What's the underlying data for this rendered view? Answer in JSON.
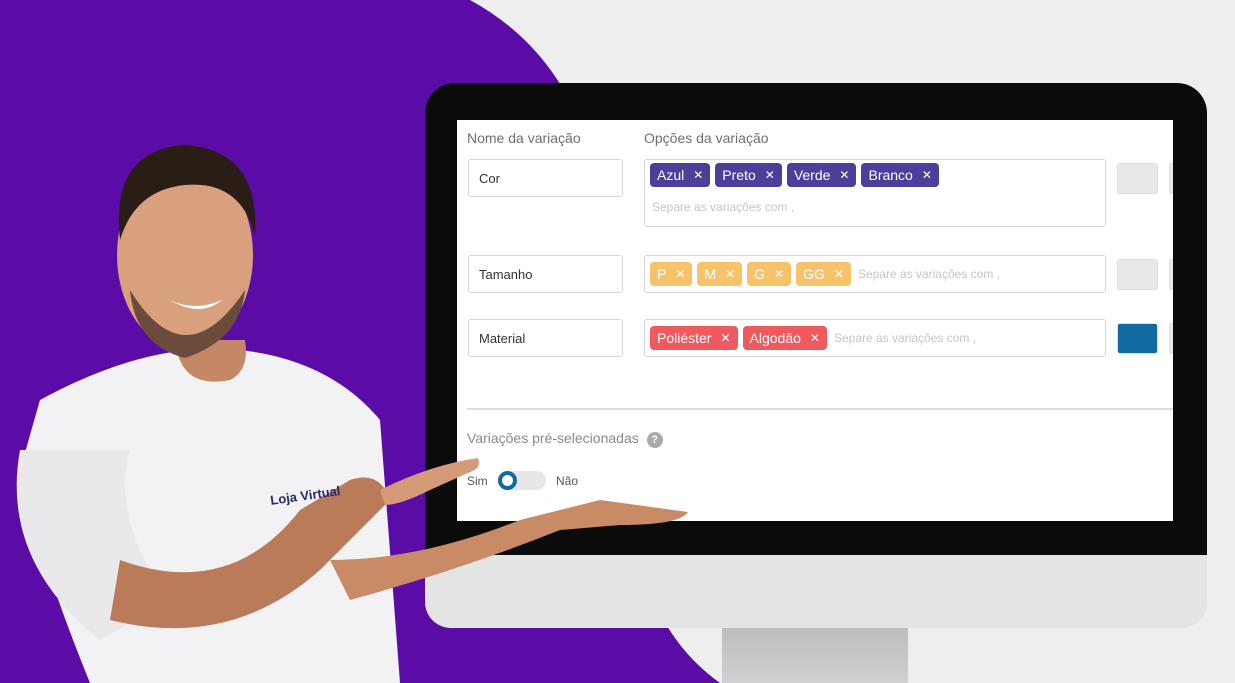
{
  "shirt_logo": "Loja Virtual",
  "form": {
    "name_header": "Nome da variação",
    "options_header": "Opções da variação",
    "placeholder": "Separe as variações com ,",
    "rows": [
      {
        "name": "Cor",
        "tag_color": "#4a3f9a",
        "tags": [
          "Azul",
          "Preto",
          "Verde",
          "Branco"
        ],
        "action_color": "#e8e8e8"
      },
      {
        "name": "Tamanho",
        "tag_color": "#f6c36a",
        "tags": [
          "P",
          "M",
          "G",
          "GG"
        ],
        "action_color": "#e8e8e8"
      },
      {
        "name": "Material",
        "tag_color": "#ef5a5f",
        "tags": [
          "Poliéster",
          "Algodão"
        ],
        "action_color": "#0f6aa2"
      }
    ],
    "preselected_label": "Variações pré-selecionadas",
    "toggle_yes": "Sim",
    "toggle_no": "Não",
    "toggle_state": "Sim"
  },
  "colors": {
    "background_purple": "#5b0ca6",
    "toggle_accent": "#0f6aa2"
  }
}
